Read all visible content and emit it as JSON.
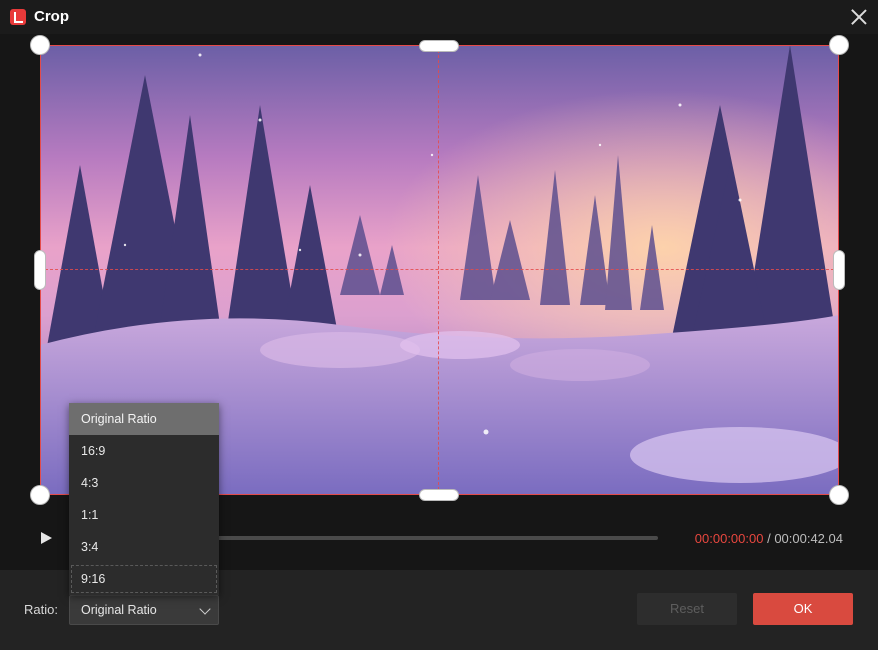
{
  "window": {
    "title": "Crop",
    "app_icon": "app-logo-icon",
    "close_icon": "close-icon"
  },
  "player": {
    "current_time": "00:00:00:00",
    "separator": " / ",
    "duration": "00:00:42.04",
    "play_icon": "play-icon",
    "progress": 0
  },
  "ratio": {
    "label": "Ratio:",
    "selected": "Original Ratio",
    "options": [
      "Original Ratio",
      "16:9",
      "4:3",
      "1:1",
      "3:4",
      "9:16"
    ]
  },
  "buttons": {
    "reset": "Reset",
    "ok": "OK"
  },
  "colors": {
    "accent": "#d94a3f",
    "crop_border": "#e44b4b",
    "time_current": "#e8473f"
  }
}
